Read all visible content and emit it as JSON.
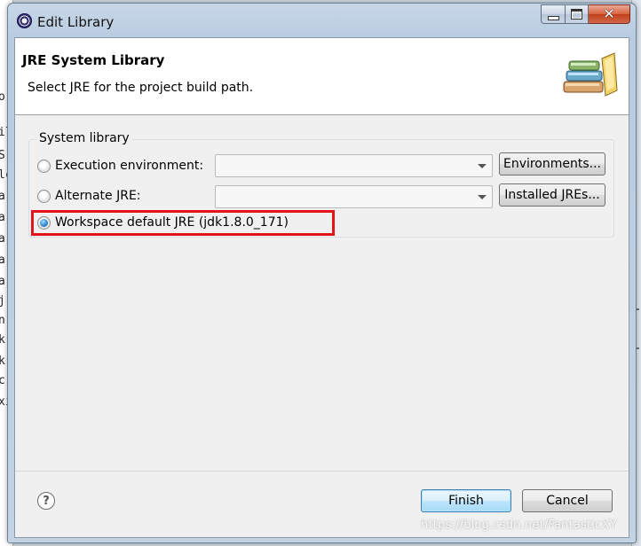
{
  "window": {
    "title": "Edit Library",
    "controls": {
      "minimize": "minimize",
      "maximize": "maximize",
      "close": "✕"
    }
  },
  "header": {
    "title": "JRE System Library",
    "description": "Select JRE for the project build path.",
    "icon": "library-books-icon"
  },
  "group": {
    "legend": "System library",
    "options": [
      {
        "label": "Execution environment:",
        "selected": false,
        "combo_value": "",
        "button": "Environments..."
      },
      {
        "label": "Alternate JRE:",
        "selected": false,
        "combo_value": "",
        "button": "Installed JREs..."
      },
      {
        "label": "Workspace default JRE (jdk1.8.0_171)",
        "selected": true
      }
    ]
  },
  "footer": {
    "help": "?",
    "finish": "Finish",
    "cancel": "Cancel"
  },
  "annotation": {
    "color": "#e3141c"
  },
  "watermark": "https://blog.csdn.net/FantasticXY",
  "background_editor_chars": [
    "o",
    "il",
    "S",
    "lc",
    "a",
    "a",
    "a",
    "a",
    "a",
    "j",
    "n",
    "k",
    "k",
    "c",
    "xi"
  ]
}
